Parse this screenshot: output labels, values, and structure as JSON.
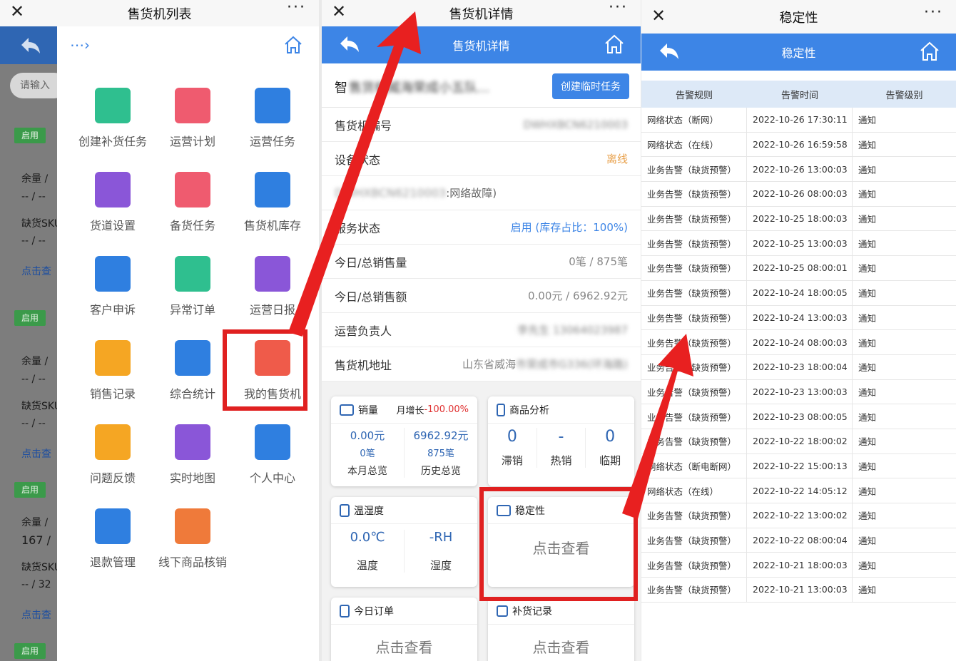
{
  "panel1": {
    "window_title": "售货机列表",
    "search_placeholder": "请输入",
    "bg_labels": {
      "enabled": "启用",
      "remain": "余量 /",
      "dash": "-- / --",
      "sku": "缺货SKU",
      "view": "点击查",
      "v167": "167 /",
      "v32": "-- / 32"
    },
    "menu": [
      {
        "label": "创建补货任务",
        "icon": "plus-icon",
        "color": "#2fbf8f"
      },
      {
        "label": "运营计划",
        "icon": "plan-icon",
        "color": "#ef5b6f"
      },
      {
        "label": "运营任务",
        "icon": "task-icon",
        "color": "#2f7fe0"
      },
      {
        "label": "货道设置",
        "icon": "cart-icon",
        "color": "#8a56d8"
      },
      {
        "label": "备货任务",
        "icon": "stock-icon",
        "color": "#ef5b6f"
      },
      {
        "label": "售货机库存",
        "icon": "cubes-icon",
        "color": "#2f7fe0"
      },
      {
        "label": "客户申诉",
        "icon": "appeal-icon",
        "color": "#2f7fe0"
      },
      {
        "label": "异常订单",
        "icon": "exception-icon",
        "color": "#2fbf8f"
      },
      {
        "label": "运营日报",
        "icon": "report-icon",
        "color": "#8a56d8"
      },
      {
        "label": "销售记录",
        "icon": "sales-icon",
        "color": "#f5a623"
      },
      {
        "label": "综合统计",
        "icon": "pie-icon",
        "color": "#2f7fe0"
      },
      {
        "label": "我的售货机",
        "icon": "vending-icon",
        "color": "#ef5b4a"
      },
      {
        "label": "问题反馈",
        "icon": "feedback-icon",
        "color": "#f5a623"
      },
      {
        "label": "实时地图",
        "icon": "map-icon",
        "color": "#8a56d8"
      },
      {
        "label": "个人中心",
        "icon": "user-icon",
        "color": "#2f7fe0"
      },
      {
        "label": "退款管理",
        "icon": "wallet-icon",
        "color": "#2f7fe0"
      },
      {
        "label": "线下商品核销",
        "icon": "box-icon",
        "color": "#ef7a3a"
      }
    ]
  },
  "panel2": {
    "window_title": "售货机详情",
    "header_title": "售货机详情",
    "name_prefix": "智",
    "name_blurred": "售货机威海荣成小五队...",
    "create_btn": "创建临时任务",
    "rows": [
      {
        "label": "售货机编号",
        "value": "DWHXBCN6210003",
        "blur": true
      },
      {
        "label": "设备状态",
        "value": "离线",
        "color": "#e8a04a"
      },
      {
        "label": "DWHXBCN6210003",
        "value": ":网络故障)",
        "blur_label": true
      },
      {
        "label": "服务状态",
        "value": "启用 (库存占比：100%)",
        "color": "#3d85e6"
      },
      {
        "label": "今日/总销售量",
        "value": "0笔 / 875笔"
      },
      {
        "label": "今日/总销售额",
        "value": "0.00元 / 6962.92元"
      },
      {
        "label": "运营负责人",
        "value": "李先生 13064023987",
        "blur": true
      },
      {
        "label": "售货机地址",
        "value": "山东省威海",
        "value_blur": "市荣成市G336(环海路)"
      }
    ],
    "sales_card": {
      "title": "销量",
      "growth_label": "月增长",
      "growth_value": "-100.00%",
      "m_amount": "0.00元",
      "m_count": "0笔",
      "m_caption": "本月总览",
      "h_amount": "6962.92元",
      "h_count": "875笔",
      "h_caption": "历史总览"
    },
    "goods_card": {
      "title": "商品分析",
      "v1": "0",
      "l1": "滞销",
      "v2": "-",
      "l2": "热销",
      "v3": "0",
      "l3": "临期"
    },
    "temp_card": {
      "title": "温湿度",
      "temp": "0.0℃",
      "temp_l": "温度",
      "hum": "-RH",
      "hum_l": "湿度"
    },
    "stab_card": {
      "title": "稳定性",
      "action": "点击查看"
    },
    "order_card": {
      "title": "今日订单",
      "action": "点击查看"
    },
    "replen_card": {
      "title": "补货记录",
      "action": "点击查看"
    }
  },
  "panel3": {
    "window_title": "稳定性",
    "header_title": "稳定性",
    "columns": [
      "告警规则",
      "告警时间",
      "告警级别"
    ],
    "rows": [
      [
        "网络状态（断网）",
        "2022-10-26 17:30:11",
        "通知"
      ],
      [
        "网络状态（在线）",
        "2022-10-26 16:59:58",
        "通知"
      ],
      [
        "业务告警（缺货预警）",
        "2022-10-26 13:00:03",
        "通知"
      ],
      [
        "业务告警（缺货预警）",
        "2022-10-26 08:00:03",
        "通知"
      ],
      [
        "业务告警（缺货预警）",
        "2022-10-25 18:00:03",
        "通知"
      ],
      [
        "业务告警（缺货预警）",
        "2022-10-25 13:00:03",
        "通知"
      ],
      [
        "业务告警（缺货预警）",
        "2022-10-25 08:00:01",
        "通知"
      ],
      [
        "业务告警（缺货预警）",
        "2022-10-24 18:00:05",
        "通知"
      ],
      [
        "业务告警（缺货预警）",
        "2022-10-24 13:00:03",
        "通知"
      ],
      [
        "业务告警（缺货预警）",
        "2022-10-24 08:00:03",
        "通知"
      ],
      [
        "业务告警（缺货预警）",
        "2022-10-23 18:00:04",
        "通知"
      ],
      [
        "业务告警（缺货预警）",
        "2022-10-23 13:00:03",
        "通知"
      ],
      [
        "业务告警（缺货预警）",
        "2022-10-23 08:00:05",
        "通知"
      ],
      [
        "业务告警（缺货预警）",
        "2022-10-22 18:00:02",
        "通知"
      ],
      [
        "网络状态（断电断网）",
        "2022-10-22 15:00:13",
        "通知"
      ],
      [
        "网络状态（在线）",
        "2022-10-22 14:05:12",
        "通知"
      ],
      [
        "业务告警（缺货预警）",
        "2022-10-22 13:00:02",
        "通知"
      ],
      [
        "业务告警（缺货预警）",
        "2022-10-22 08:00:04",
        "通知"
      ],
      [
        "业务告警（缺货预警）",
        "2022-10-21 18:00:03",
        "通知"
      ],
      [
        "业务告警（缺货预警）",
        "2022-10-21 13:00:03",
        "通知"
      ]
    ]
  },
  "colors": {
    "brand_blue": "#3d85e6",
    "highlight_red": "#e02020",
    "offline_orange": "#e8a04a"
  }
}
